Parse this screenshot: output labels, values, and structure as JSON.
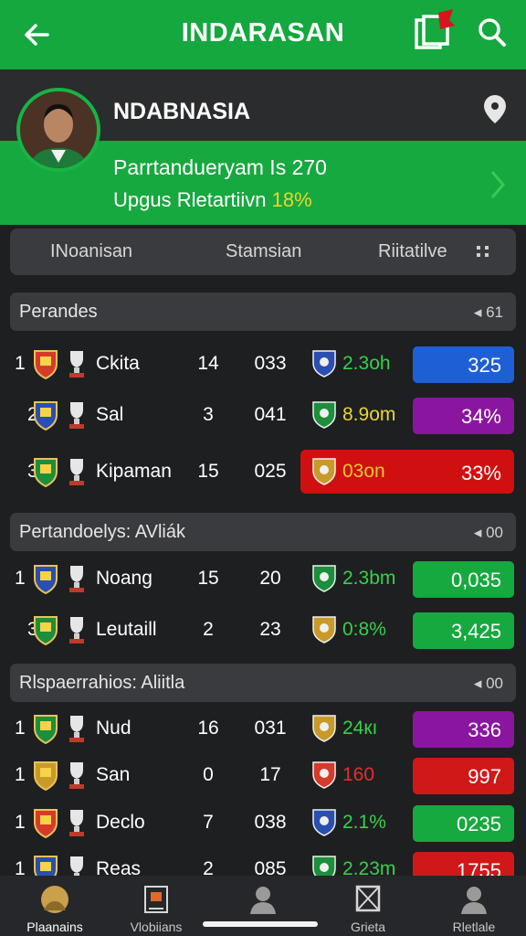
{
  "appbar": {
    "title": "INDARASAN"
  },
  "profile": {
    "name": "NDABNASIA",
    "line1": "Parrtanduеryam Is 270",
    "line2_label": "Upgus Rletartiivn",
    "line2_pct": "18%"
  },
  "tabs": [
    "INoanisan",
    "Stamsian",
    "Riitatilve"
  ],
  "sections": [
    {
      "name": "Perandes",
      "count": "◂ 61",
      "rows": [
        {
          "rank": "1",
          "name": "Ckita",
          "c1": "14",
          "c2": "033",
          "stat": "2.3oh",
          "statColor": "#35d14a",
          "val": "325",
          "valColor": "#1f5fd6"
        },
        {
          "rank": "2",
          "name": "Sal",
          "c1": "3",
          "c2": "041",
          "stat": "8.9om",
          "statColor": "#e8d630",
          "val": "34%",
          "valColor": "#8a16a0"
        },
        {
          "rank": "3",
          "name": "Kipaman",
          "c1": "15",
          "c2": "025",
          "stat": "03on",
          "statColor": "#e8c830",
          "val": "33%",
          "valColor": "#d01010"
        }
      ]
    },
    {
      "name": "Pertandoelys: AVliák",
      "count": "◂ 00",
      "rows": [
        {
          "rank": "1",
          "name": "Noang",
          "c1": "15",
          "c2": "20",
          "stat": "2.3bm",
          "statColor": "#35d14a",
          "val": "0,035",
          "valColor": "#16a93f"
        },
        {
          "rank": "3",
          "name": "Leutaill",
          "c1": "2",
          "c2": "23",
          "stat": "0:8%",
          "statColor": "#35d14a",
          "val": "3,425",
          "valColor": "#16a93f"
        }
      ]
    },
    {
      "name": "Rlspaerrahios: Aliitla",
      "count": "◂ 00",
      "rows": [
        {
          "rank": "1",
          "name": "Nud",
          "c1": "16",
          "c2": "031",
          "stat": "24кı",
          "statColor": "#35d14a",
          "val": "336",
          "valColor": "#8a16a0"
        },
        {
          "rank": "1",
          "name": "San",
          "c1": "0",
          "c2": "17",
          "stat": "160",
          "statColor": "#e03030",
          "val": "997",
          "valColor": "#d01818"
        },
        {
          "rank": "1",
          "name": "Declo",
          "c1": "7",
          "c2": "038",
          "stat": "2.1%",
          "statColor": "#35d14a",
          "val": "0235",
          "valColor": "#16a93f"
        },
        {
          "rank": "1",
          "name": "Reas",
          "c1": "2",
          "c2": "085",
          "stat": "2.23m",
          "statColor": "#35d14a",
          "val": "1755",
          "valColor": "#d01818"
        }
      ]
    }
  ],
  "nav": [
    {
      "label": "Plaanains",
      "icon": "coin-icon"
    },
    {
      "label": "Vlobiians",
      "icon": "chart-icon"
    },
    {
      "label": "",
      "icon": "person-icon"
    },
    {
      "label": "Grieta",
      "icon": "box-icon"
    },
    {
      "label": "Rletlale",
      "icon": "person-icon"
    }
  ]
}
